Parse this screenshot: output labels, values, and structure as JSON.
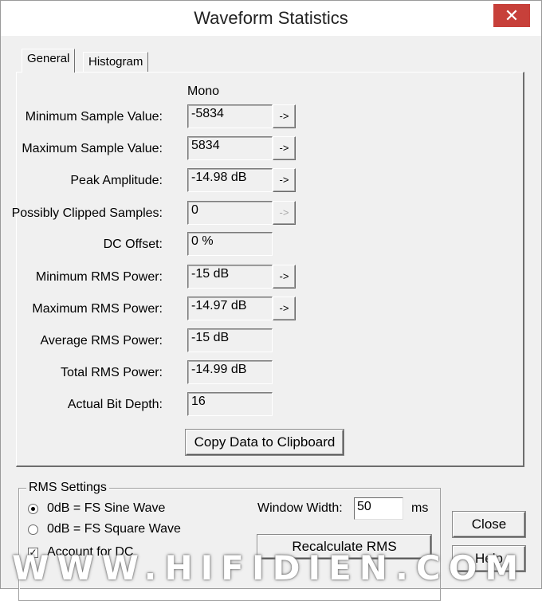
{
  "window": {
    "title": "Waveform Statistics",
    "close_glyph": "✕"
  },
  "tabs": [
    {
      "label": "General",
      "active": true
    },
    {
      "label": "Histogram",
      "active": false
    }
  ],
  "channel_header": "Mono",
  "stats": [
    {
      "label": "Minimum Sample Value:",
      "value": "-5834",
      "arrow": "->",
      "arrow_state": "enabled"
    },
    {
      "label": "Maximum Sample Value:",
      "value": "5834",
      "arrow": "->",
      "arrow_state": "enabled"
    },
    {
      "label": "Peak Amplitude:",
      "value": "-14.98 dB",
      "arrow": "->",
      "arrow_state": "enabled"
    },
    {
      "label": "Possibly Clipped Samples:",
      "value": "0",
      "arrow": "->",
      "arrow_state": "disabled"
    },
    {
      "label": "DC Offset:",
      "value": "0 %"
    },
    {
      "label": "Minimum RMS Power:",
      "value": "-15 dB",
      "arrow": "->",
      "arrow_state": "enabled"
    },
    {
      "label": "Maximum RMS Power:",
      "value": "-14.97 dB",
      "arrow": "->",
      "arrow_state": "enabled"
    },
    {
      "label": "Average RMS Power:",
      "value": "-15 dB"
    },
    {
      "label": "Total RMS Power:",
      "value": "-14.99 dB"
    },
    {
      "label": "Actual Bit Depth:",
      "value": "16"
    }
  ],
  "copy_button": {
    "label": "Copy Data to Clipboard"
  },
  "rms_settings": {
    "title": "RMS Settings",
    "options": [
      {
        "label": "0dB = FS Sine Wave",
        "selected": true
      },
      {
        "label": "0dB = FS Square Wave",
        "selected": false
      }
    ],
    "account_dc": {
      "label": "Account for DC",
      "checked": true
    },
    "window_width_label": "Window Width:",
    "window_width_value": "50",
    "window_width_unit": "ms",
    "recalculate_label": "Recalculate RMS"
  },
  "buttons": {
    "close": "Close",
    "help": "Help"
  },
  "watermark": "WWW.HIFIDIEN.COM"
}
